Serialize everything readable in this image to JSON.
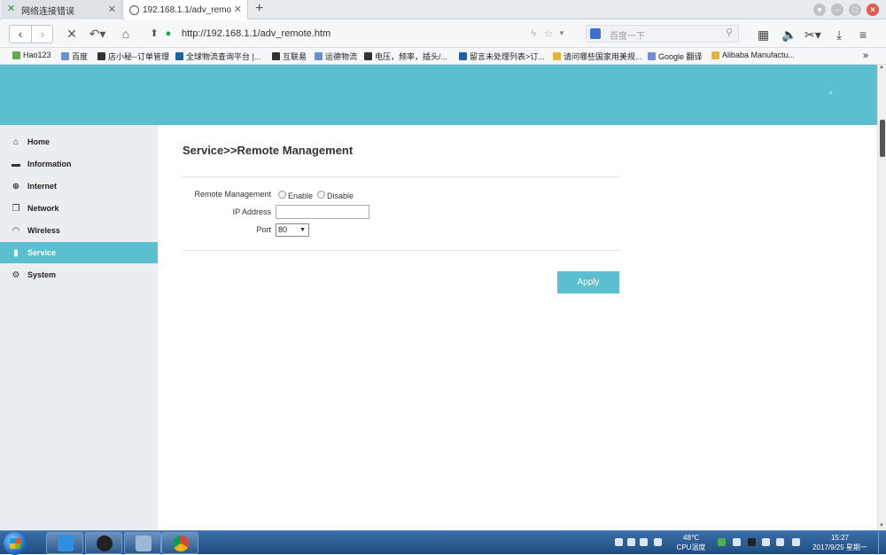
{
  "browser": {
    "tabs": [
      {
        "label": "网络连接错误"
      },
      {
        "label": "192.168.1.1/adv_remot..."
      }
    ],
    "url": "http://192.168.1.1/adv_remote.htm",
    "search_placeholder": "百度一下",
    "bookmarks": [
      "Hao123",
      "百度",
      "店小秘--订单管理",
      "全球物流查询平台 |...",
      "互联易",
      "运德物流",
      "电压，频率，插头/...",
      "留言未处理列表>订...",
      "请问哪些国家用美规...",
      "Google 翻译",
      "Alibaba Manufactu..."
    ]
  },
  "sidebar": {
    "items": [
      {
        "label": "Home",
        "icon": "home-icon"
      },
      {
        "label": "Information",
        "icon": "chat-icon"
      },
      {
        "label": "Internet",
        "icon": "globe-icon"
      },
      {
        "label": "Network",
        "icon": "network-icon"
      },
      {
        "label": "Wireless",
        "icon": "wifi-icon"
      },
      {
        "label": "Service",
        "icon": "bar-chart-icon",
        "active": true
      },
      {
        "label": "System",
        "icon": "gear-icon"
      }
    ]
  },
  "main": {
    "title": "Service>>Remote Management",
    "remote_management_label": "Remote Management",
    "enable_label": "Enable",
    "disable_label": "Disable",
    "ip_address_label": "IP Address",
    "ip_address_value": "",
    "port_label": "Port",
    "port_value": "80",
    "apply_label": "Apply"
  },
  "taskbar": {
    "temp": "48℃",
    "temp_label": "CPU温度",
    "time": "15:27",
    "date": "2017/9/25 星期一"
  },
  "colors": {
    "accent": "#5bbfcf",
    "sidebar_bg": "#eaedf1"
  }
}
